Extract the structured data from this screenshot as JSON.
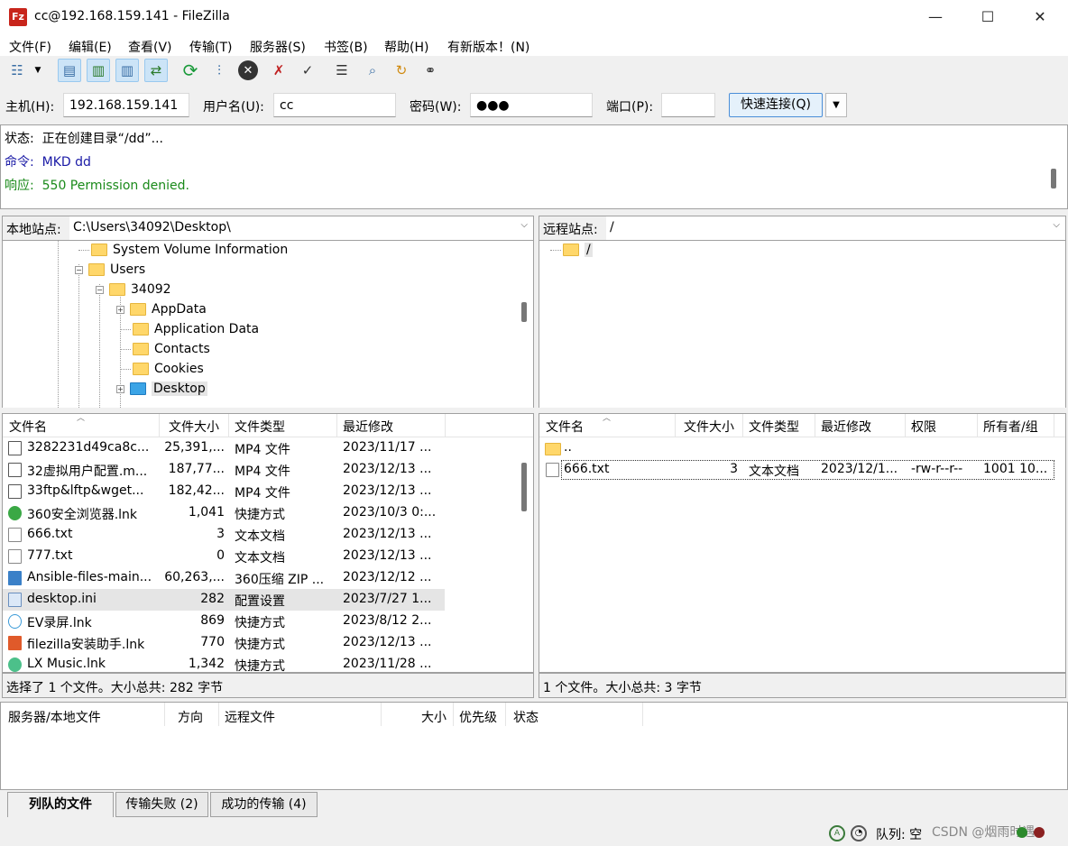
{
  "window": {
    "title": "cc@192.168.159.141 - FileZilla",
    "app_icon": "Fz",
    "minimize": "—",
    "maximize": "☐",
    "close": "✕"
  },
  "menu": [
    "文件(F)",
    "编辑(E)",
    "查看(V)",
    "传输(T)",
    "服务器(S)",
    "书签(B)",
    "帮助(H)",
    "有新版本！(N)"
  ],
  "quickconnect": {
    "host_label": "主机(H):",
    "host_value": "192.168.159.141",
    "user_label": "用户名(U):",
    "user_value": "cc",
    "pass_label": "密码(W):",
    "pass_value": "●●●",
    "port_label": "端口(P):",
    "port_value": "",
    "button": "快速连接(Q)"
  },
  "log": [
    {
      "prefix": "状态:",
      "text": "正在创建目录“/dd”...",
      "color": "#000000"
    },
    {
      "prefix": "命令:",
      "text": "MKD dd",
      "color": "#1a1aa6"
    },
    {
      "prefix": "响应:",
      "text": "550 Permission denied.",
      "color": "#1a8a1a"
    }
  ],
  "local": {
    "site_label": "本地站点:",
    "path": "C:\\Users\\34092\\Desktop\\",
    "tree": {
      "system_volume": "System Volume Information",
      "users": "Users",
      "user_dir": "34092",
      "appdata": "AppData",
      "application_data": "Application Data",
      "contacts": "Contacts",
      "cookies": "Cookies",
      "desktop": "Desktop"
    },
    "columns": [
      "文件名",
      "文件大小",
      "文件类型",
      "最近修改"
    ],
    "files": [
      {
        "name": "3282231d49ca8c...",
        "size": "25,391,...",
        "type": "MP4 文件",
        "modified": "2023/11/17 ..."
      },
      {
        "name": "32虚拟用户配置.m...",
        "size": "187,77...",
        "type": "MP4 文件",
        "modified": "2023/12/13 ..."
      },
      {
        "name": "33ftp&lftp&wget...",
        "size": "182,42...",
        "type": "MP4 文件",
        "modified": "2023/12/13 ..."
      },
      {
        "name": "360安全浏览器.lnk",
        "size": "1,041",
        "type": "快捷方式",
        "modified": "2023/10/3 0:..."
      },
      {
        "name": "666.txt",
        "size": "3",
        "type": "文本文档",
        "modified": "2023/12/13 ..."
      },
      {
        "name": "777.txt",
        "size": "0",
        "type": "文本文档",
        "modified": "2023/12/13 ..."
      },
      {
        "name": "Ansible-files-main...",
        "size": "60,263,...",
        "type": "360压缩 ZIP ...",
        "modified": "2023/12/12 ..."
      },
      {
        "name": "desktop.ini",
        "size": "282",
        "type": "配置设置",
        "modified": "2023/7/27 1..."
      },
      {
        "name": "EV录屏.lnk",
        "size": "869",
        "type": "快捷方式",
        "modified": "2023/8/12 2..."
      },
      {
        "name": "filezilla安装助手.lnk",
        "size": "770",
        "type": "快捷方式",
        "modified": "2023/12/13 ..."
      },
      {
        "name": "LX Music.lnk",
        "size": "1,342",
        "type": "快捷方式",
        "modified": "2023/11/28 ..."
      }
    ],
    "status": "选择了 1 个文件。大小总共: 282 字节"
  },
  "remote": {
    "site_label": "远程站点:",
    "path": "/",
    "tree_root": "/",
    "columns": [
      "文件名",
      "文件大小",
      "文件类型",
      "最近修改",
      "权限",
      "所有者/组"
    ],
    "parent": "..",
    "files": [
      {
        "name": "666.txt",
        "size": "3",
        "type": "文本文档",
        "modified": "2023/12/1...",
        "perms": "-rw-r--r--",
        "owner": "1001 10..."
      }
    ],
    "status": "1 个文件。大小总共: 3 字节"
  },
  "queue": {
    "columns": [
      "服务器/本地文件",
      "方向",
      "远程文件",
      "大小",
      "优先级",
      "状态"
    ],
    "tabs": [
      "列队的文件",
      "传输失败 (2)",
      "成功的传输 (4)"
    ]
  },
  "statusbar": {
    "queue_text": "队列: 空",
    "watermark": "CSDN @烟雨时遇"
  },
  "colors": {
    "selected_row": "#e5e5e5",
    "log_command": "#1a1aa6",
    "log_response": "#1a8a1a",
    "accent": "#4a8ed8"
  }
}
